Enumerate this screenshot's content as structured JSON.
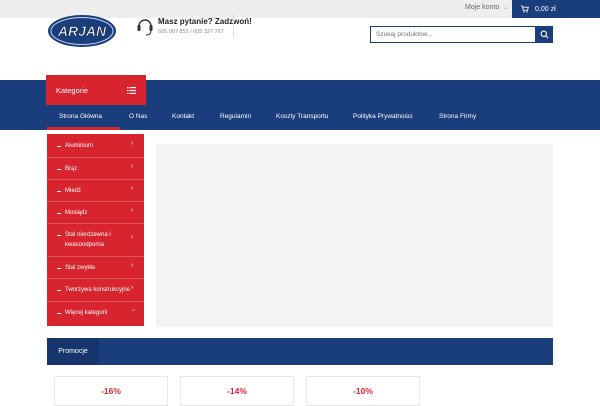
{
  "topbar": {
    "account_label": "Moje konto",
    "cart_total": "0,00 zł"
  },
  "header": {
    "logo_text": "ARJAN",
    "phone_question": "Masz pytanie? Zadzwoń!",
    "phone_numbers": "605 907 853 / 605 327 767",
    "search_placeholder": "Szukaj produktów..."
  },
  "categories": {
    "heading": "Kategorie",
    "items": [
      {
        "label": "Aluminium"
      },
      {
        "label": "Brąz"
      },
      {
        "label": "Miedź"
      },
      {
        "label": "Mosiądz"
      },
      {
        "label": "Stal nierdzewna i kwasoodporna"
      },
      {
        "label": "Stal zwykła"
      },
      {
        "label": "Tworzywa konstrukcyjne"
      },
      {
        "label": "Więcej kategorii"
      }
    ]
  },
  "nav": {
    "items": [
      {
        "label": "Strona Główna"
      },
      {
        "label": "O Nas"
      },
      {
        "label": "Kontakt"
      },
      {
        "label": "Regulamin"
      },
      {
        "label": "Koszty Transportu"
      },
      {
        "label": "Polityka Prywatności"
      },
      {
        "label": "Strona Firmy"
      }
    ]
  },
  "promo": {
    "tab_label": "Promocje",
    "cards": [
      {
        "discount": "-16%"
      },
      {
        "discount": "-14%"
      },
      {
        "discount": "-10%"
      }
    ]
  },
  "colors": {
    "brand_blue": "#1a3d7c",
    "accent_red": "#d8242f"
  }
}
